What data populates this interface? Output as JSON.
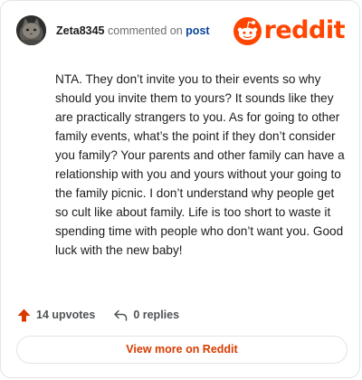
{
  "header": {
    "username": "Zeta8345",
    "action_text": "commented on",
    "post_link": "post",
    "logo_text": "reddit"
  },
  "comment": {
    "body": "NTA. They don’t invite you to their events so why should you invite them to yours? It sounds like they are practically strangers to you. As for going to other family events, what’s the point if they don’t consider you family? Your parents and other family can have a relationship with you and yours without your going to the family picnic. I don’t understand why people get so cult like about family. Life is too short to waste it spending time with people who don’t want you. Good luck with the new baby!"
  },
  "stats": {
    "upvotes": "14 upvotes",
    "replies": "0 replies"
  },
  "footer": {
    "view_more": "View more on Reddit"
  },
  "colors": {
    "brand": "#ff4500",
    "link": "#0a449b",
    "cta": "#d93a00"
  },
  "icons": {
    "avatar": "cat-avatar",
    "logo": "reddit-snoo-icon",
    "upvote": "upvote-arrow-icon",
    "reply": "reply-arrow-icon"
  }
}
